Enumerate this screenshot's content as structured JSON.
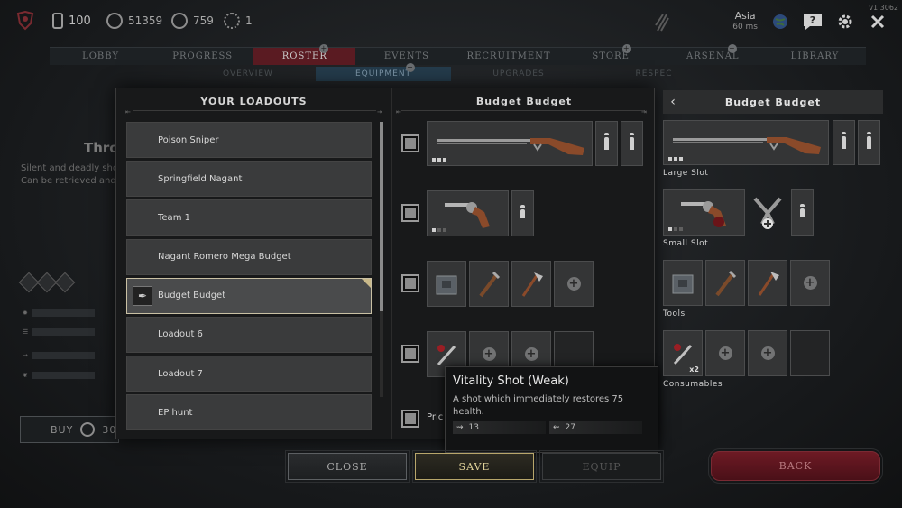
{
  "version": "v1.3062",
  "top": {
    "bloodline": "100",
    "hunt_dollars": "51359",
    "blood_bonds": "759",
    "event_points": "1",
    "region": "Asia",
    "ping": "60 ms"
  },
  "nav": {
    "tabs": [
      "LOBBY",
      "PROGRESS",
      "ROSTER",
      "EVENTS",
      "RECRUITMENT",
      "STORE",
      "ARSENAL",
      "LIBRARY"
    ],
    "subtabs": [
      "OVERVIEW",
      "EQUIPMENT",
      "UPGRADES",
      "RESPEC"
    ]
  },
  "background": {
    "title": "Thro",
    "desc_line1": "Silent and deadly sho",
    "desc_line2": "Can be retrieved and"
  },
  "buy": {
    "label": "BUY",
    "price": "30"
  },
  "loadouts": {
    "title": "YOUR LOADOUTS",
    "items": [
      "Poison Sniper",
      "Springfield Nagant",
      "Team 1",
      "Nagant Romero Mega Budget",
      "Budget Budget",
      "Loadout 6",
      "Loadout 7",
      "EP hunt"
    ]
  },
  "preview": {
    "title": "Budget Budget",
    "price_label": "Pric"
  },
  "tooltip": {
    "title": "Vitality Shot (Weak)",
    "desc": "A shot which immediately restores 75 health.",
    "stat1": "13",
    "stat2": "27"
  },
  "buttons": {
    "close": "CLOSE",
    "save": "SAVE",
    "equip": "EQUIP",
    "back": "BACK"
  },
  "right_panel": {
    "title": "Budget Budget",
    "large_slot": "Large Slot",
    "small_slot": "Small Slot",
    "tools": "Tools",
    "consumables": "Consumables",
    "consumable_count": "x2"
  }
}
